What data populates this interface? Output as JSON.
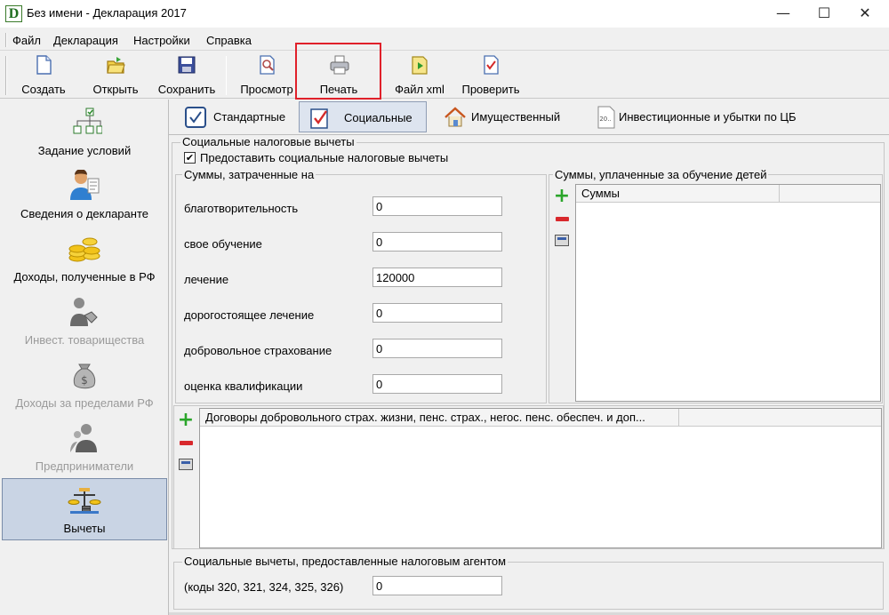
{
  "window": {
    "icon_letter": "D",
    "title": "Без имени - Декларация 2017",
    "minimize_glyph": "—",
    "maximize_glyph": "☐",
    "close_glyph": "✕"
  },
  "menu": [
    "Файл",
    "Декларация",
    "Настройки",
    "Справка"
  ],
  "toolbar": {
    "create": "Создать",
    "open": "Открыть",
    "save": "Сохранить",
    "preview": "Просмотр",
    "print": "Печать",
    "xml": "Файл xml",
    "check": "Проверить"
  },
  "nav": [
    {
      "label": "Задание условий",
      "enabled": true,
      "icon": "tree-icon"
    },
    {
      "label": "Сведения о декларанте",
      "enabled": true,
      "icon": "person-icon"
    },
    {
      "label": "Доходы, полученные в РФ",
      "enabled": true,
      "icon": "coins-icon"
    },
    {
      "label": "Инвест. товарищества",
      "enabled": false,
      "icon": "handshake-icon"
    },
    {
      "label": "Доходы за пределами РФ",
      "enabled": false,
      "icon": "money-bag-icon"
    },
    {
      "label": "Предприниматели",
      "enabled": false,
      "icon": "businessman-icon"
    },
    {
      "label": "Вычеты",
      "enabled": true,
      "active": true,
      "icon": "scales-icon"
    }
  ],
  "tabs": {
    "standard": "Стандартные",
    "social": "Социальные",
    "property": "Имущественный",
    "investment": "Инвестиционные и убытки по ЦБ",
    "investment_icon_text": "20.."
  },
  "social": {
    "group_title": "Социальные налоговые вычеты",
    "provide_checkbox_label": "Предоставить социальные налоговые вычеты",
    "provide_checked": true,
    "check_glyph": "✔",
    "expenses_title": "Суммы, затраченные на",
    "fields": [
      {
        "label": "благотворительность",
        "value": "0"
      },
      {
        "label": "свое обучение",
        "value": "0"
      },
      {
        "label": "лечение",
        "value": "120000"
      },
      {
        "label": "дорогостоящее лечение",
        "value": "0"
      },
      {
        "label": "добровольное страхование",
        "value": "0"
      },
      {
        "label": "оценка квалификации",
        "value": "0"
      }
    ],
    "children_title": "Суммы, уплаченные за обучение детей",
    "children_column": "Суммы",
    "contracts_column": "Договоры добровольного страх. жизни, пенс. страх., негос. пенс. обеспеч. и доп...",
    "agent_title": "Социальные вычеты, предоставленные налоговым агентом",
    "agent_codes_label": "(коды 320, 321, 324, 325, 326)",
    "agent_value": "0",
    "plus_glyph": "+"
  }
}
